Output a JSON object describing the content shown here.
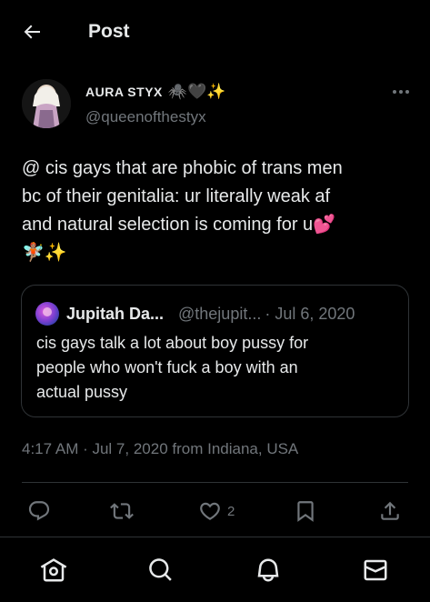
{
  "header": {
    "title": "Post",
    "back_icon": "arrow-left-icon"
  },
  "author": {
    "display_name": "AURA STYX",
    "name_emojis": "🕷️🖤✨",
    "handle": "@queenofthestyx"
  },
  "post": {
    "line1": "@ cis gays that are phobic of trans men",
    "line2": "bc of their genitalia: ur literally weak af",
    "line3": "and natural selection is coming for u💕",
    "line4": "🧚🏽✨"
  },
  "quote": {
    "name": "Jupitah Da...",
    "handle": "@thejupit...",
    "date": "· Jul 6, 2020",
    "line1": "cis gays talk a lot about boy pussy for",
    "line2": "people who won't fuck a boy with an",
    "line3": "actual pussy"
  },
  "meta": {
    "timestamp": "4:17 AM · Jul 7, 2020 from Indiana, USA"
  },
  "actions": {
    "like_count": "2"
  },
  "colors": {
    "background": "#000000",
    "text": "#e7e9ea",
    "muted": "#71767b",
    "border": "#2f3336",
    "heart": "#f91880"
  }
}
